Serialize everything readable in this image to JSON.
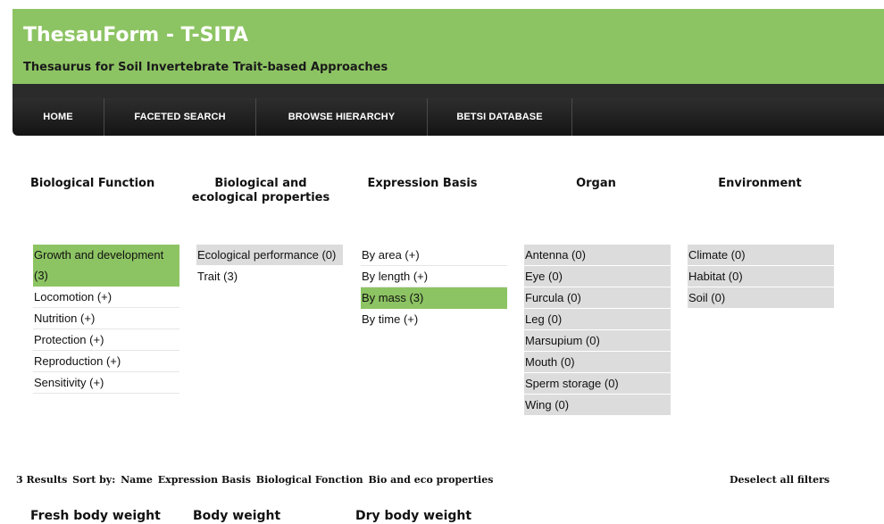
{
  "header": {
    "title": "ThesauForm - T-SITA",
    "subtitle": "Thesaurus for Soil Invertebrate Trait-based Approaches",
    "bg_color": "#8dc463"
  },
  "nav": {
    "items": [
      "HOME",
      "FACETED SEARCH",
      "BROWSE HIERARCHY",
      "BETSI DATABASE"
    ]
  },
  "facets": {
    "biological_function": {
      "heading": "Biological Function",
      "items": [
        {
          "label": "Growth and development (3)",
          "state": "selected"
        },
        {
          "label": "Locomotion (+)",
          "state": "normal"
        },
        {
          "label": "Nutrition (+)",
          "state": "normal"
        },
        {
          "label": "Protection (+)",
          "state": "normal"
        },
        {
          "label": "Reproduction (+)",
          "state": "normal"
        },
        {
          "label": "Sensitivity (+)",
          "state": "normal"
        }
      ]
    },
    "bio_eco_properties": {
      "heading": "Biological and ecological properties",
      "items": [
        {
          "label": "Ecological performance (0)",
          "state": "zero"
        },
        {
          "label": "Trait (3)",
          "state": "normal"
        }
      ]
    },
    "expression_basis": {
      "heading": "Expression Basis",
      "items": [
        {
          "label": "By area (+)",
          "state": "normal"
        },
        {
          "label": "By length (+)",
          "state": "normal"
        },
        {
          "label": "By mass (3)",
          "state": "selected"
        },
        {
          "label": "By time (+)",
          "state": "normal"
        }
      ]
    },
    "organ": {
      "heading": "Organ",
      "items": [
        {
          "label": "Antenna (0)",
          "state": "zero"
        },
        {
          "label": "Eye (0)",
          "state": "zero"
        },
        {
          "label": "Furcula (0)",
          "state": "zero"
        },
        {
          "label": "Leg (0)",
          "state": "zero"
        },
        {
          "label": "Marsupium (0)",
          "state": "zero"
        },
        {
          "label": "Mouth (0)",
          "state": "zero"
        },
        {
          "label": "Sperm storage (0)",
          "state": "zero"
        },
        {
          "label": "Wing (0)",
          "state": "zero"
        }
      ]
    },
    "environment": {
      "heading": "Environment",
      "items": [
        {
          "label": "Climate (0)",
          "state": "zero"
        },
        {
          "label": "Habitat (0)",
          "state": "zero"
        },
        {
          "label": "Soil (0)",
          "state": "zero"
        }
      ]
    }
  },
  "results": {
    "count_label": "3 Results",
    "sort_label": "Sort by:",
    "sort_options": [
      "Name",
      "Expression Basis",
      "Biological Fonction",
      "Bio and eco properties"
    ],
    "deselect_label": "Deselect all filters",
    "titles": [
      "Fresh body weight",
      "Body weight",
      "Dry body weight"
    ]
  },
  "colors": {
    "selected": "#8dc463",
    "zero": "#dcdcdc",
    "nav_bg": "#1e1e1e"
  }
}
